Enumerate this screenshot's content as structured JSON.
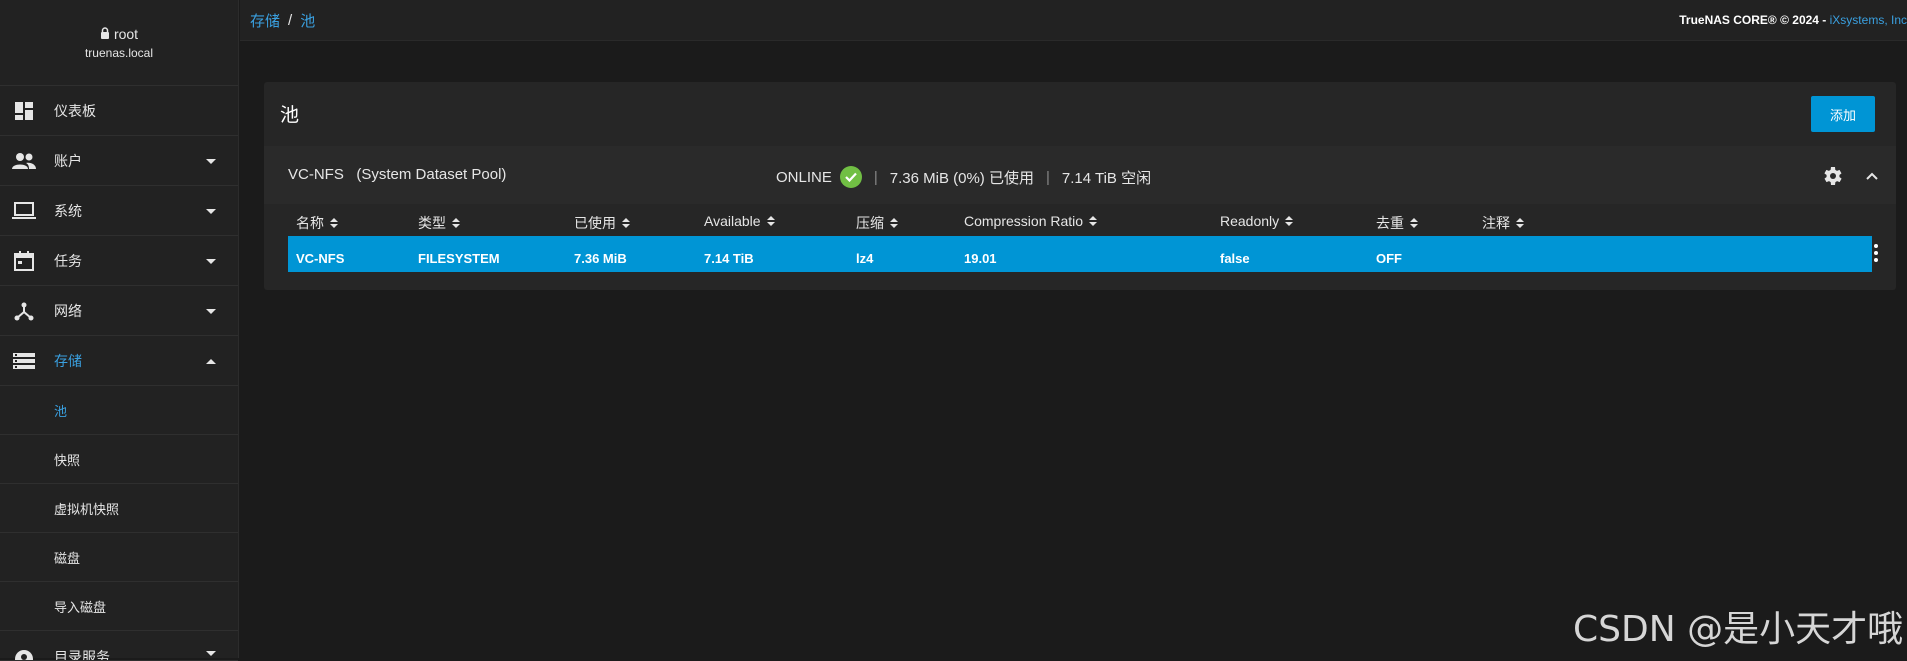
{
  "user": {
    "name": "root",
    "host": "truenas.local",
    "lock_icon": "lock-icon"
  },
  "sidebar": {
    "items": [
      {
        "label": "仪表板",
        "icon": "dashboard-icon",
        "expandable": false
      },
      {
        "label": "账户",
        "icon": "people-icon",
        "expandable": true
      },
      {
        "label": "系统",
        "icon": "laptop-icon",
        "expandable": true
      },
      {
        "label": "任务",
        "icon": "calendar-icon",
        "expandable": true
      },
      {
        "label": "网络",
        "icon": "network-icon",
        "expandable": true
      },
      {
        "label": "存储",
        "icon": "storage-icon",
        "expandable": true,
        "expanded": true,
        "active": true
      }
    ],
    "storage_subitems": [
      "池",
      "快照",
      "虚拟机快照",
      "磁盘",
      "导入磁盘"
    ],
    "next_item": {
      "label": "目录服务",
      "icon": "directory-icon"
    }
  },
  "breadcrumb": {
    "parent": "存储",
    "separator": "/",
    "current": "池"
  },
  "copyright": {
    "text": "TrueNAS CORE® © 2024 - ",
    "link": "iXsystems, Inc"
  },
  "card": {
    "title": "池",
    "add_label": "添加"
  },
  "pool": {
    "name": "VC-NFS",
    "tag": "(System Dataset Pool)",
    "status": "ONLINE",
    "used": "7.36 MiB (0%) 已使用",
    "free": "7.14 TiB 空闲"
  },
  "table": {
    "columns": [
      "名称",
      "类型",
      "已使用",
      "Available",
      "压缩",
      "Compression Ratio",
      "Readonly",
      "去重",
      "注释"
    ],
    "rows": [
      {
        "name": "VC-NFS",
        "type": "FILESYSTEM",
        "used": "7.36 MiB",
        "available": "7.14 TiB",
        "compression": "lz4",
        "ratio": "19.01",
        "readonly": "false",
        "dedup": "OFF",
        "comment": ""
      }
    ]
  },
  "watermark": "CSDN @是小天才哦",
  "colors": {
    "accent": "#0095d5",
    "link": "#3aa0e0",
    "ok": "#71bf44",
    "bg": "#1b1b1b",
    "panel": "#262626"
  }
}
